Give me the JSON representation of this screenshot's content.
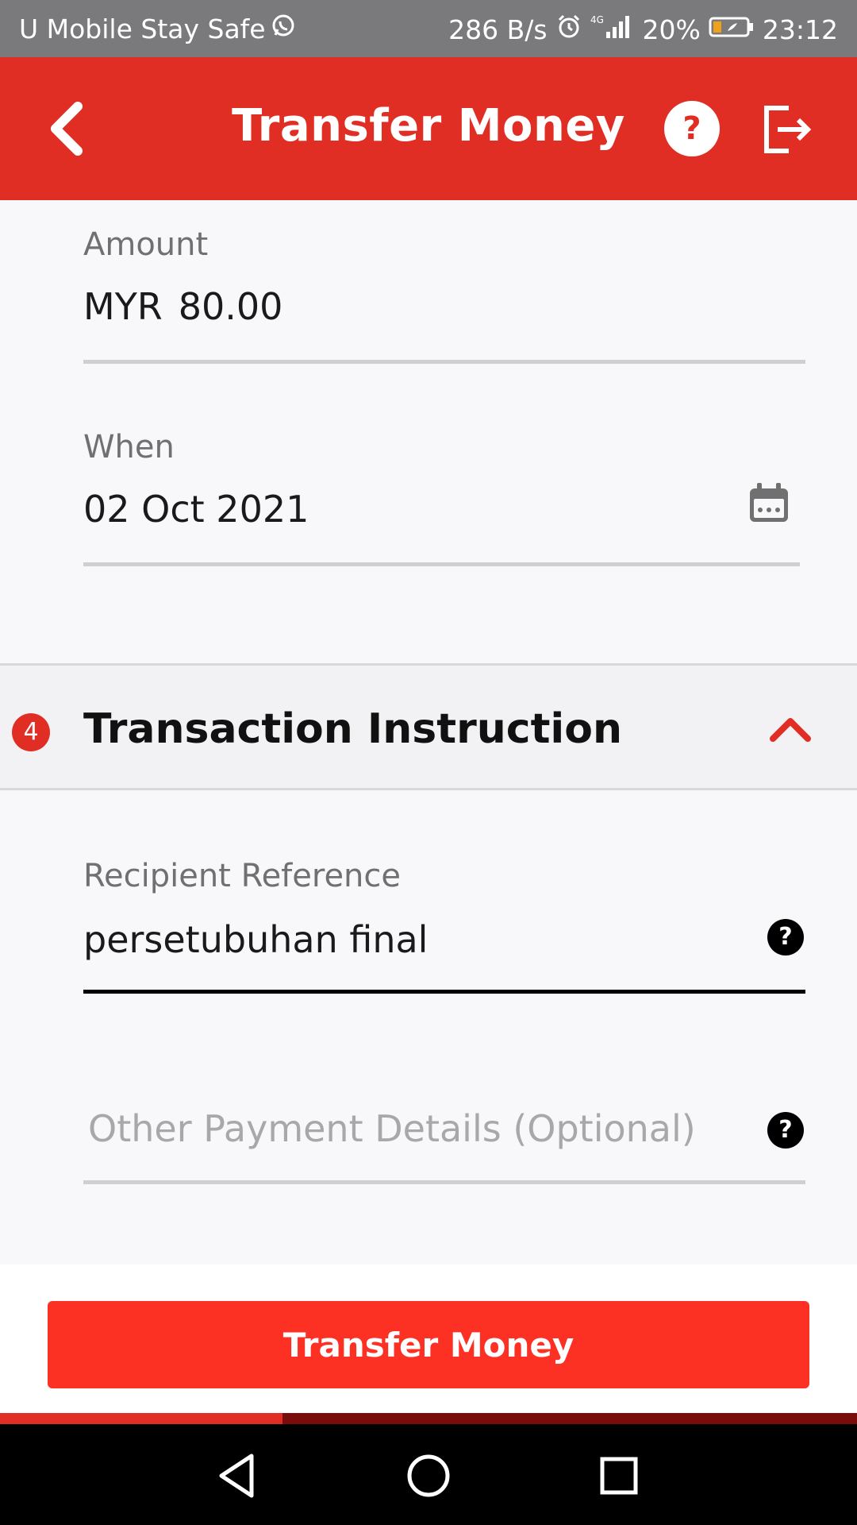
{
  "status_bar": {
    "carrier": "U Mobile Stay Safe",
    "net_speed": "286 B/s",
    "battery": "20%",
    "time": "23:12",
    "icons": [
      "whatsapp-icon",
      "alarm-icon",
      "4g-signal-icon",
      "battery-icon"
    ]
  },
  "header": {
    "title": "Transfer Money",
    "back_icon": "chevron-left-icon",
    "help_icon": "question-circle-icon",
    "logout_icon": "logout-icon"
  },
  "form": {
    "amount": {
      "label": "Amount",
      "currency": "MYR",
      "value": "80.00"
    },
    "when": {
      "label": "When",
      "value": "02 Oct 2021",
      "icon": "calendar-icon"
    }
  },
  "section": {
    "step": "4",
    "title": "Transaction Instruction",
    "toggle_icon": "chevron-up-icon"
  },
  "instruction": {
    "recipient_reference": {
      "label": "Recipient Reference",
      "value": "persetubuhan final",
      "help": "?"
    },
    "other_details": {
      "placeholder": "Other Payment Details (Optional)",
      "help": "?"
    }
  },
  "action": {
    "submit_label": "Transfer Money"
  },
  "progress": {
    "fraction": 0.33
  },
  "colors": {
    "brand": "#e12e24",
    "button": "#fd3024",
    "status_bar": "#7a797c"
  },
  "nav": [
    "back-triangle-icon",
    "home-circle-icon",
    "recents-square-icon"
  ]
}
